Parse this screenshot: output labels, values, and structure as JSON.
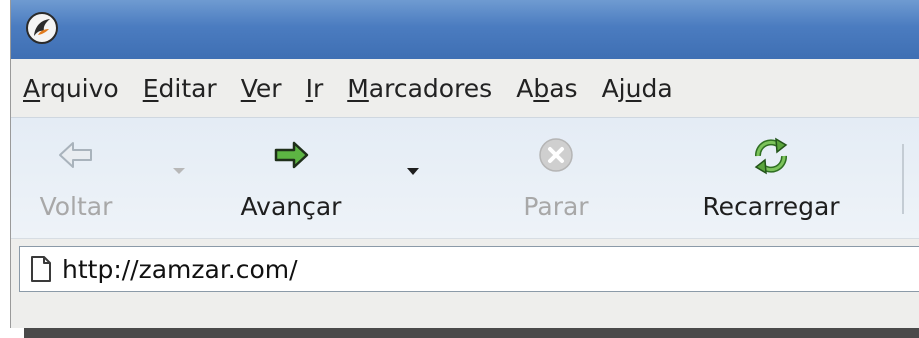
{
  "menubar": {
    "items": [
      {
        "pre": "",
        "key": "A",
        "post": "rquivo"
      },
      {
        "pre": "",
        "key": "E",
        "post": "ditar"
      },
      {
        "pre": "",
        "key": "V",
        "post": "er"
      },
      {
        "pre": "",
        "key": "I",
        "post": "r"
      },
      {
        "pre": "",
        "key": "M",
        "post": "arcadores"
      },
      {
        "pre": "A",
        "key": "b",
        "post": "as"
      },
      {
        "pre": "Aj",
        "key": "u",
        "post": "da"
      }
    ]
  },
  "toolbar": {
    "back_label": "Voltar",
    "forward_label": "Avançar",
    "stop_label": "Parar",
    "reload_label": "Recarregar"
  },
  "icons": {
    "app": "firebird-app-icon",
    "back": "back-arrow-icon",
    "forward": "forward-arrow-icon",
    "stop": "stop-icon",
    "reload": "reload-icon",
    "page": "page-icon"
  },
  "colors": {
    "titlebar": "#4b7cc0",
    "forward_arrow": "#4ea43a",
    "reload": "#3f8a2f",
    "disabled": "#a8a8a8"
  },
  "address_bar": {
    "url": "http://zamzar.com/"
  }
}
